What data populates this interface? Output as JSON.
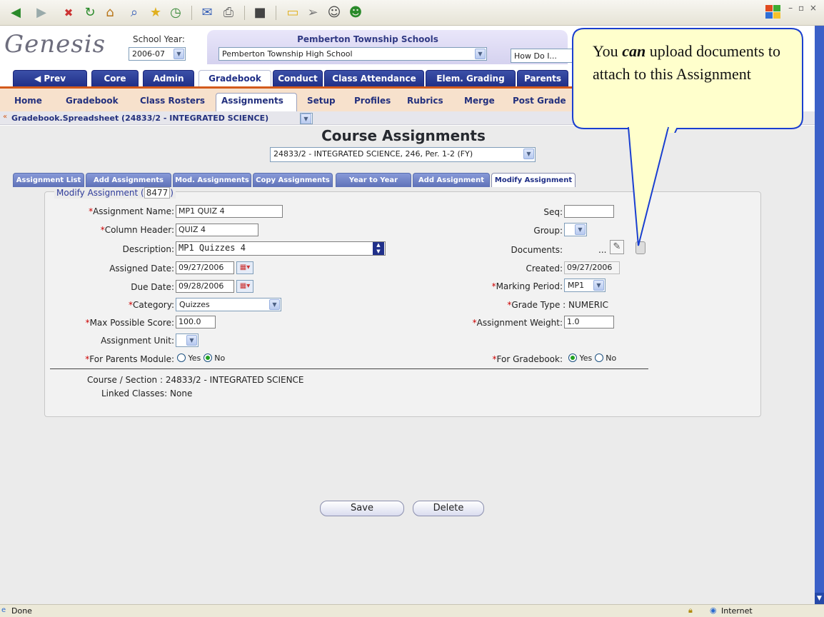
{
  "header": {
    "school_year_label": "School Year:",
    "school_year": "2006-07",
    "district": "Pemberton Township Schools",
    "school": "Pemberton Township High School",
    "help": "How Do I..."
  },
  "logo_text": "Genesis",
  "main_tabs": [
    "Prev",
    "Core",
    "Admin",
    "Gradebook",
    "Conduct",
    "Class Attendance",
    "Elem. Grading",
    "Parents"
  ],
  "sub_nav": [
    "Home",
    "Gradebook",
    "Class Rosters",
    "Assignments",
    "Setup",
    "Profiles",
    "Rubrics",
    "Merge",
    "Post Grade"
  ],
  "breadcrumb": "Gradebook.Spreadsheet (24833/2 - INTEGRATED SCIENCE)",
  "page_title": "Course Assignments",
  "course_select": "24833/2 - INTEGRATED SCIENCE, 246, Per. 1-2 (FY)",
  "assignment_tabs": [
    "Assignment List",
    "Add Assignments",
    "Mod. Assignments",
    "Copy Assignments",
    "Year to Year",
    "Add Assignment",
    "Modify Assignment"
  ],
  "fieldset": {
    "legend": "Modify Assignment (",
    "id": "8477",
    "legend_close": ")"
  },
  "form": {
    "assignment_name_label": "Assignment Name:",
    "assignment_name": "MP1 QUIZ 4",
    "column_header_label": "Column Header:",
    "column_header": "QUIZ 4",
    "description_label": "Description:",
    "description": "MP1 Quizzes 4",
    "assigned_date_label": "Assigned Date:",
    "assigned_date": "09/27/2006",
    "due_date_label": "Due Date:",
    "due_date": "09/28/2006",
    "category_label": "Category:",
    "category": "Quizzes",
    "max_score_label": "Max Possible Score:",
    "max_score": "100.0",
    "assignment_unit_label": "Assignment Unit:",
    "parents_label": "For Parents Module:",
    "yes": "Yes",
    "no": "No",
    "seq_label": "Seq:",
    "group_label": "Group:",
    "documents_label": "Documents:",
    "documents_ellipsis": "...",
    "created_label": "Created:",
    "created": "09/27/2006",
    "marking_period_label": "Marking Period:",
    "marking_period": "MP1",
    "grade_type": "Grade Type : NUMERIC",
    "weight_label": "Assignment Weight:",
    "weight": "1.0",
    "gradebook_label": "For Gradebook:",
    "course_section": "Course / Section : 24833/2 - INTEGRATED SCIENCE",
    "linked_classes": "Linked Classes: None",
    "parents_selected": "No",
    "gradebook_selected": "Yes"
  },
  "buttons": {
    "save": "Save",
    "delete": "Delete"
  },
  "callout": {
    "pre": "You ",
    "emph": "can",
    "post": " upload documents to attach to this Assignment"
  },
  "status": {
    "left": "Done",
    "zone": "Internet"
  },
  "colors": {
    "nav_blue": "#1f2e86",
    "accent_orange": "#d35a1b",
    "subnav_bg": "#f7e1cc",
    "callout_fill": "#ffffcc",
    "callout_border": "#1a3fd0"
  },
  "icons": [
    "back-icon",
    "forward-icon",
    "stop-icon",
    "refresh-icon",
    "home-icon",
    "search-icon",
    "favorites-icon",
    "history-icon",
    "mail-icon",
    "print-icon",
    "edit-icon",
    "folder-icon",
    "messenger-icon",
    "users-icon",
    "calendar-icon",
    "attach-icon",
    "trash-icon",
    "lock-icon",
    "globe-icon"
  ]
}
